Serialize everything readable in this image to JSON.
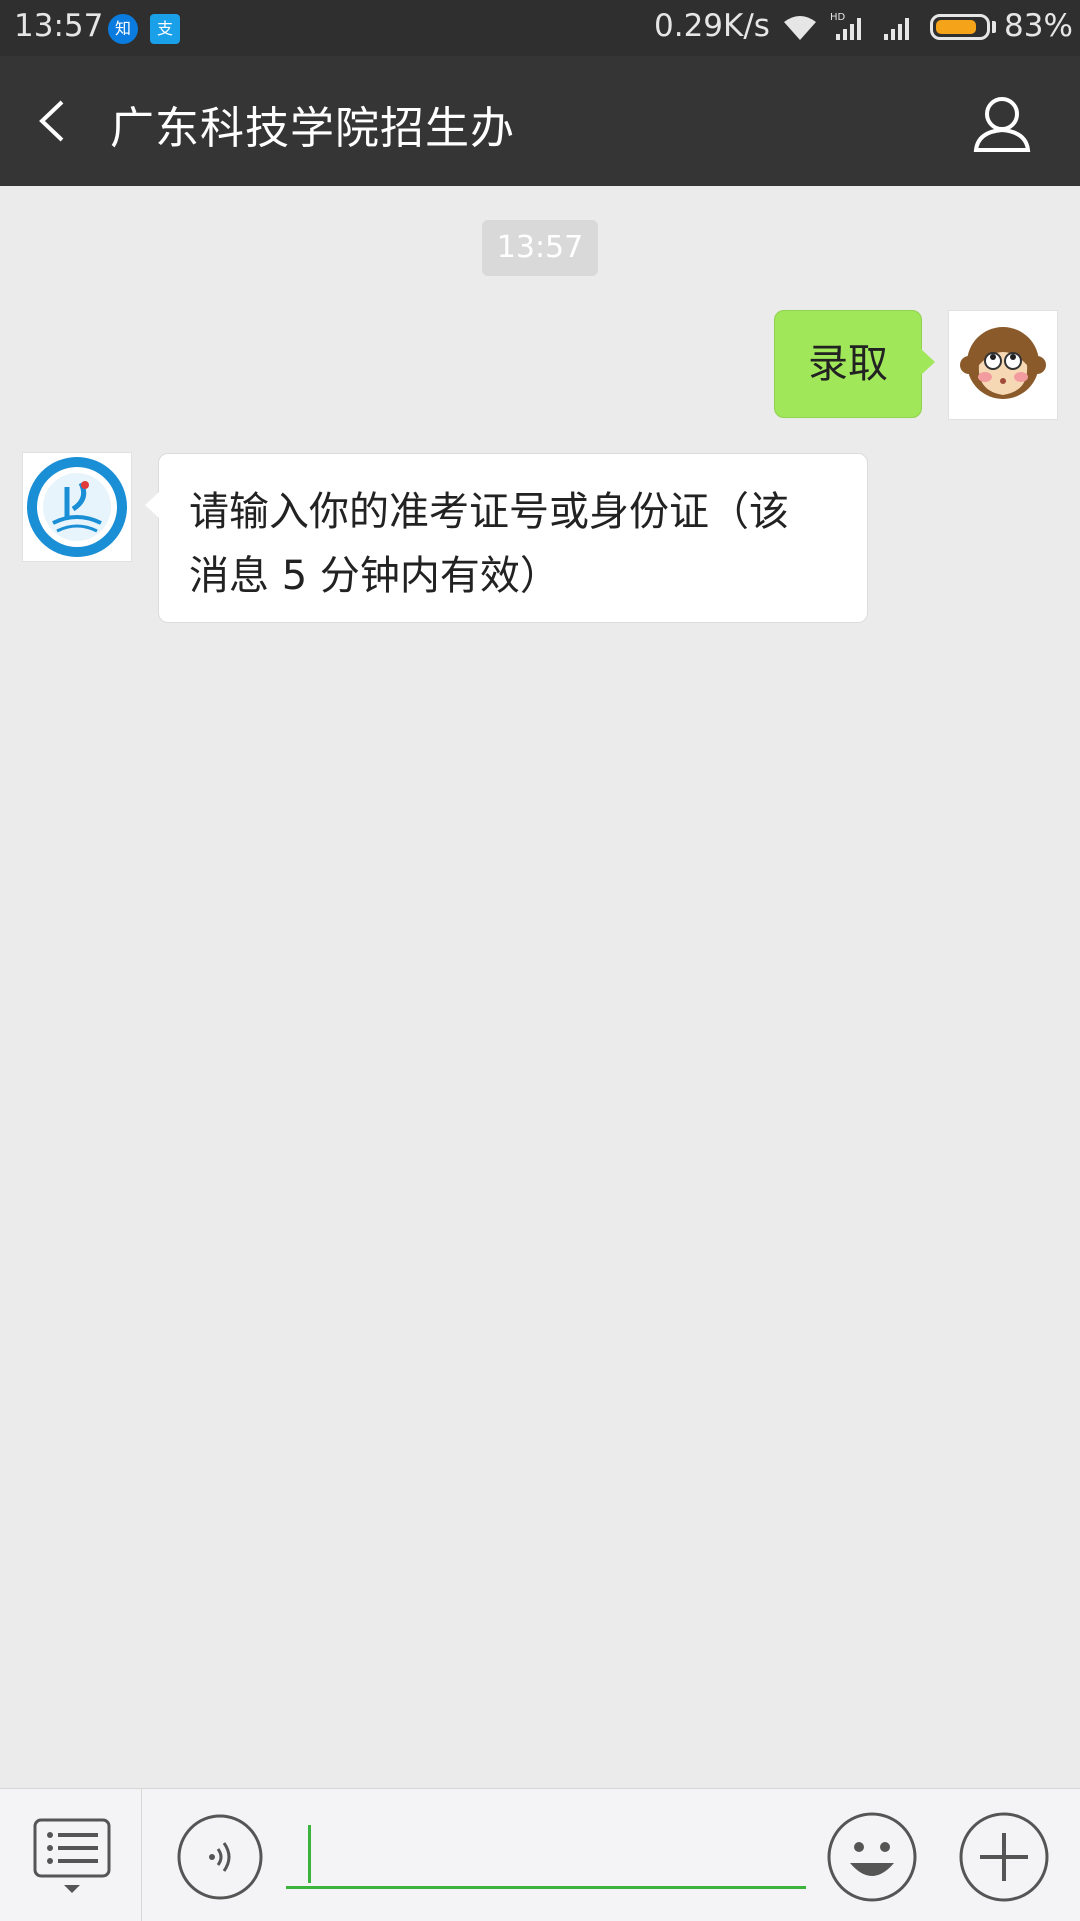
{
  "status_bar": {
    "time": "13:57",
    "app_icons": [
      "知",
      "支"
    ],
    "network_speed": "0.29K/s",
    "network_tag": "HD",
    "battery_percent": "83%",
    "battery_level": 0.83,
    "battery_color": "#f5a319"
  },
  "header": {
    "title": "广东科技学院招生办",
    "back_icon": "chevron-left-icon",
    "profile_icon": "person-icon"
  },
  "chat": {
    "timestamp": "13:57",
    "messages": [
      {
        "from": "me",
        "text": "录取",
        "bubble_color": "#a0e75a"
      },
      {
        "from": "bot",
        "line1": "请输入你的准考证号或身份证（该",
        "line2": "消息 5 分钟内有效）",
        "bubble_color": "#ffffff"
      }
    ]
  },
  "input_bar": {
    "value": "",
    "accent": "#3cb33c",
    "icons": [
      "menu-icon",
      "voice-icon",
      "emoji-icon",
      "plus-icon"
    ]
  }
}
